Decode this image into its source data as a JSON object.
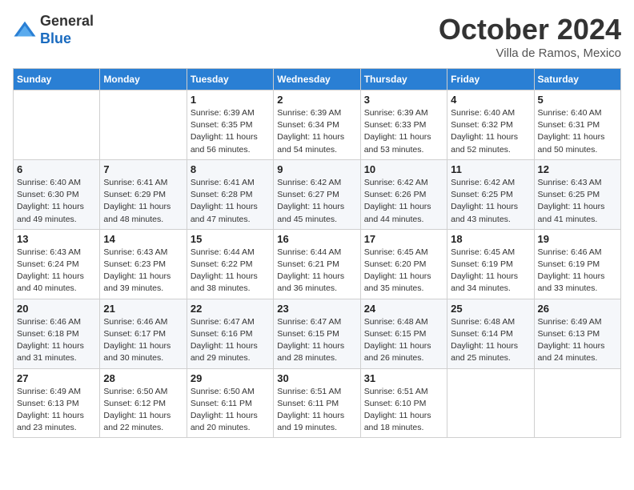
{
  "logo": {
    "general": "General",
    "blue": "Blue"
  },
  "title": "October 2024",
  "location": "Villa de Ramos, Mexico",
  "days_header": [
    "Sunday",
    "Monday",
    "Tuesday",
    "Wednesday",
    "Thursday",
    "Friday",
    "Saturday"
  ],
  "weeks": [
    [
      {
        "day": "",
        "info": ""
      },
      {
        "day": "",
        "info": ""
      },
      {
        "day": "1",
        "info": "Sunrise: 6:39 AM\nSunset: 6:35 PM\nDaylight: 11 hours and 56 minutes."
      },
      {
        "day": "2",
        "info": "Sunrise: 6:39 AM\nSunset: 6:34 PM\nDaylight: 11 hours and 54 minutes."
      },
      {
        "day": "3",
        "info": "Sunrise: 6:39 AM\nSunset: 6:33 PM\nDaylight: 11 hours and 53 minutes."
      },
      {
        "day": "4",
        "info": "Sunrise: 6:40 AM\nSunset: 6:32 PM\nDaylight: 11 hours and 52 minutes."
      },
      {
        "day": "5",
        "info": "Sunrise: 6:40 AM\nSunset: 6:31 PM\nDaylight: 11 hours and 50 minutes."
      }
    ],
    [
      {
        "day": "6",
        "info": "Sunrise: 6:40 AM\nSunset: 6:30 PM\nDaylight: 11 hours and 49 minutes."
      },
      {
        "day": "7",
        "info": "Sunrise: 6:41 AM\nSunset: 6:29 PM\nDaylight: 11 hours and 48 minutes."
      },
      {
        "day": "8",
        "info": "Sunrise: 6:41 AM\nSunset: 6:28 PM\nDaylight: 11 hours and 47 minutes."
      },
      {
        "day": "9",
        "info": "Sunrise: 6:42 AM\nSunset: 6:27 PM\nDaylight: 11 hours and 45 minutes."
      },
      {
        "day": "10",
        "info": "Sunrise: 6:42 AM\nSunset: 6:26 PM\nDaylight: 11 hours and 44 minutes."
      },
      {
        "day": "11",
        "info": "Sunrise: 6:42 AM\nSunset: 6:25 PM\nDaylight: 11 hours and 43 minutes."
      },
      {
        "day": "12",
        "info": "Sunrise: 6:43 AM\nSunset: 6:25 PM\nDaylight: 11 hours and 41 minutes."
      }
    ],
    [
      {
        "day": "13",
        "info": "Sunrise: 6:43 AM\nSunset: 6:24 PM\nDaylight: 11 hours and 40 minutes."
      },
      {
        "day": "14",
        "info": "Sunrise: 6:43 AM\nSunset: 6:23 PM\nDaylight: 11 hours and 39 minutes."
      },
      {
        "day": "15",
        "info": "Sunrise: 6:44 AM\nSunset: 6:22 PM\nDaylight: 11 hours and 38 minutes."
      },
      {
        "day": "16",
        "info": "Sunrise: 6:44 AM\nSunset: 6:21 PM\nDaylight: 11 hours and 36 minutes."
      },
      {
        "day": "17",
        "info": "Sunrise: 6:45 AM\nSunset: 6:20 PM\nDaylight: 11 hours and 35 minutes."
      },
      {
        "day": "18",
        "info": "Sunrise: 6:45 AM\nSunset: 6:19 PM\nDaylight: 11 hours and 34 minutes."
      },
      {
        "day": "19",
        "info": "Sunrise: 6:46 AM\nSunset: 6:19 PM\nDaylight: 11 hours and 33 minutes."
      }
    ],
    [
      {
        "day": "20",
        "info": "Sunrise: 6:46 AM\nSunset: 6:18 PM\nDaylight: 11 hours and 31 minutes."
      },
      {
        "day": "21",
        "info": "Sunrise: 6:46 AM\nSunset: 6:17 PM\nDaylight: 11 hours and 30 minutes."
      },
      {
        "day": "22",
        "info": "Sunrise: 6:47 AM\nSunset: 6:16 PM\nDaylight: 11 hours and 29 minutes."
      },
      {
        "day": "23",
        "info": "Sunrise: 6:47 AM\nSunset: 6:15 PM\nDaylight: 11 hours and 28 minutes."
      },
      {
        "day": "24",
        "info": "Sunrise: 6:48 AM\nSunset: 6:15 PM\nDaylight: 11 hours and 26 minutes."
      },
      {
        "day": "25",
        "info": "Sunrise: 6:48 AM\nSunset: 6:14 PM\nDaylight: 11 hours and 25 minutes."
      },
      {
        "day": "26",
        "info": "Sunrise: 6:49 AM\nSunset: 6:13 PM\nDaylight: 11 hours and 24 minutes."
      }
    ],
    [
      {
        "day": "27",
        "info": "Sunrise: 6:49 AM\nSunset: 6:13 PM\nDaylight: 11 hours and 23 minutes."
      },
      {
        "day": "28",
        "info": "Sunrise: 6:50 AM\nSunset: 6:12 PM\nDaylight: 11 hours and 22 minutes."
      },
      {
        "day": "29",
        "info": "Sunrise: 6:50 AM\nSunset: 6:11 PM\nDaylight: 11 hours and 20 minutes."
      },
      {
        "day": "30",
        "info": "Sunrise: 6:51 AM\nSunset: 6:11 PM\nDaylight: 11 hours and 19 minutes."
      },
      {
        "day": "31",
        "info": "Sunrise: 6:51 AM\nSunset: 6:10 PM\nDaylight: 11 hours and 18 minutes."
      },
      {
        "day": "",
        "info": ""
      },
      {
        "day": "",
        "info": ""
      }
    ]
  ]
}
